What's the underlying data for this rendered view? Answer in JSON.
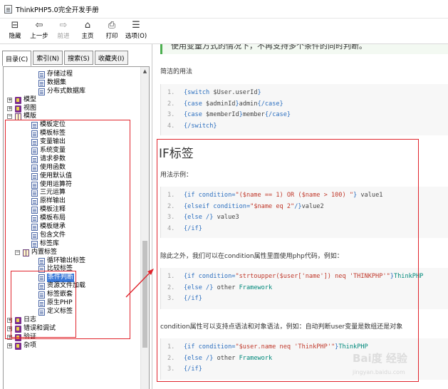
{
  "window": {
    "title": "ThinkPHP5.0完全开发手册"
  },
  "toolbar": {
    "buttons": [
      {
        "label": "隐藏",
        "icon": "hide-pane-icon",
        "glyph": "⊟",
        "disabled": false
      },
      {
        "label": "上一步",
        "icon": "back-arrow-icon",
        "glyph": "⇦",
        "disabled": false
      },
      {
        "label": "前进",
        "icon": "forward-arrow-icon",
        "glyph": "⇨",
        "disabled": true
      },
      {
        "label": "主页",
        "icon": "home-icon",
        "glyph": "⌂",
        "disabled": false
      },
      {
        "label": "打印",
        "icon": "printer-icon",
        "glyph": "⎙",
        "disabled": false
      },
      {
        "label": "选项(O)",
        "icon": "options-icon",
        "glyph": "☰",
        "disabled": false
      }
    ]
  },
  "nav_tabs": [
    {
      "label": "目录(C)",
      "active": true
    },
    {
      "label": "索引(N)",
      "active": false
    },
    {
      "label": "搜索(S)",
      "active": false
    },
    {
      "label": "收藏夹(I)",
      "active": false
    }
  ],
  "tree": [
    {
      "label": "存储过程",
      "level": 2,
      "type": "page"
    },
    {
      "label": "数据集",
      "level": 2,
      "type": "page"
    },
    {
      "label": "分布式数据库",
      "level": 2,
      "type": "page"
    },
    {
      "label": "模型",
      "level": 0,
      "type": "book",
      "expander": "+"
    },
    {
      "label": "视图",
      "level": 0,
      "type": "book",
      "expander": "+"
    },
    {
      "label": "模版",
      "level": 0,
      "type": "openbook",
      "expander": "−"
    },
    {
      "label": "模板定位",
      "level": 1,
      "type": "page"
    },
    {
      "label": "模板标签",
      "level": 1,
      "type": "page"
    },
    {
      "label": "变量输出",
      "level": 1,
      "type": "page"
    },
    {
      "label": "系统变量",
      "level": 1,
      "type": "page"
    },
    {
      "label": "请求参数",
      "level": 1,
      "type": "page"
    },
    {
      "label": "使用函数",
      "level": 1,
      "type": "page"
    },
    {
      "label": "使用默认值",
      "level": 1,
      "type": "page"
    },
    {
      "label": "使用运算符",
      "level": 1,
      "type": "page"
    },
    {
      "label": "三元运算",
      "level": 1,
      "type": "page"
    },
    {
      "label": "原样输出",
      "level": 1,
      "type": "page"
    },
    {
      "label": "模板注释",
      "level": 1,
      "type": "page"
    },
    {
      "label": "模板布局",
      "level": 1,
      "type": "page"
    },
    {
      "label": "模板继承",
      "level": 1,
      "type": "page"
    },
    {
      "label": "包含文件",
      "level": 1,
      "type": "page"
    },
    {
      "label": "标签库",
      "level": 1,
      "type": "page"
    },
    {
      "label": "内置标签",
      "level": 1,
      "type": "openbook",
      "expander": "−"
    },
    {
      "label": "循环输出标签",
      "level": 2,
      "type": "page"
    },
    {
      "label": "比较标签",
      "level": 2,
      "type": "page"
    },
    {
      "label": "条件判断",
      "level": 2,
      "type": "page",
      "selected": true
    },
    {
      "label": "资源文件加载",
      "level": 2,
      "type": "page"
    },
    {
      "label": "标签嵌套",
      "level": 2,
      "type": "page"
    },
    {
      "label": "原生PHP",
      "level": 2,
      "type": "page"
    },
    {
      "label": "定义标签",
      "level": 2,
      "type": "page"
    },
    {
      "label": "日志",
      "level": 0,
      "type": "book",
      "expander": "+"
    },
    {
      "label": "错误和调试",
      "level": 0,
      "type": "book",
      "expander": "+"
    },
    {
      "label": "验证",
      "level": 0,
      "type": "book",
      "expander": "+"
    },
    {
      "label": "杂项",
      "level": 0,
      "type": "book",
      "expander": "+"
    }
  ],
  "content": {
    "intro_text": "使用变量方式的情况下，不再支持多个条件的同时判断。",
    "simple_usage_label": "简洁的用法",
    "code1": [
      [
        {
          "t": "{switch ",
          "c": "k"
        },
        {
          "t": "$User.userId",
          "c": ""
        },
        {
          "t": "}",
          "c": "k"
        }
      ],
      [
        {
          "t": "    {case ",
          "c": "k"
        },
        {
          "t": "$adminId",
          "c": ""
        },
        {
          "t": "}",
          "c": "k"
        },
        {
          "t": "admin",
          "c": ""
        },
        {
          "t": "{/case}",
          "c": "k"
        }
      ],
      [
        {
          "t": "    {case ",
          "c": "k"
        },
        {
          "t": "$memberId",
          "c": ""
        },
        {
          "t": "}",
          "c": "k"
        },
        {
          "t": "member",
          "c": ""
        },
        {
          "t": "{/case}",
          "c": "k"
        }
      ],
      [
        {
          "t": "{/switch}",
          "c": "k"
        }
      ]
    ],
    "if_heading": "IF标签",
    "usage_example_label": "用法示例：",
    "code2": [
      [
        {
          "t": "{if condition=",
          "c": "k"
        },
        {
          "t": "\"($name == 1) OR ($name > 100) \"",
          "c": "s"
        },
        {
          "t": "} ",
          "c": "k"
        },
        {
          "t": "value1",
          "c": ""
        }
      ],
      [
        {
          "t": "{elseif condition=",
          "c": "k"
        },
        {
          "t": "\"$name eq 2\"",
          "c": "s"
        },
        {
          "t": "/}",
          "c": "k"
        },
        {
          "t": "value2",
          "c": ""
        }
      ],
      [
        {
          "t": "{else /} ",
          "c": "k"
        },
        {
          "t": "value3",
          "c": ""
        }
      ],
      [
        {
          "t": "{/if}",
          "c": "k"
        }
      ]
    ],
    "php_code_text": "除此之外，我们可以在condition属性里面使用php代码，例如：",
    "code3": [
      [
        {
          "t": "{if condition=",
          "c": "k"
        },
        {
          "t": "\"strtoupper($user['name']) neq 'THINKPHP'\"",
          "c": "s"
        },
        {
          "t": "}",
          "c": "k"
        },
        {
          "t": "ThinkPHP",
          "c": "c"
        }
      ],
      [
        {
          "t": "{else /} ",
          "c": "k"
        },
        {
          "t": "other ",
          "c": ""
        },
        {
          "t": "Framework",
          "c": "c"
        }
      ],
      [
        {
          "t": "{/if}",
          "c": "k"
        }
      ]
    ],
    "dot_syntax_text": "condition属性可以支持点语法和对象语法，例如：自动判断user变量是数组还是对象",
    "code4": [
      [
        {
          "t": "{if condition=",
          "c": "k"
        },
        {
          "t": "\"$user.name neq 'ThinkPHP'\"",
          "c": "s"
        },
        {
          "t": "}",
          "c": "k"
        },
        {
          "t": "ThinkPHP",
          "c": "c"
        }
      ],
      [
        {
          "t": "{else /} ",
          "c": "k"
        },
        {
          "t": "other ",
          "c": ""
        },
        {
          "t": "Framework",
          "c": "c"
        }
      ],
      [
        {
          "t": "{/if}",
          "c": "k"
        }
      ]
    ]
  },
  "watermark": {
    "brand": "Bai度 经验",
    "site": "jingyan.baidu.com"
  },
  "colors": {
    "annotation_red": "#e0242c",
    "code_keyword": "#2c6fbf",
    "code_string": "#c0392b",
    "selection_blue": "#3a78d8"
  }
}
